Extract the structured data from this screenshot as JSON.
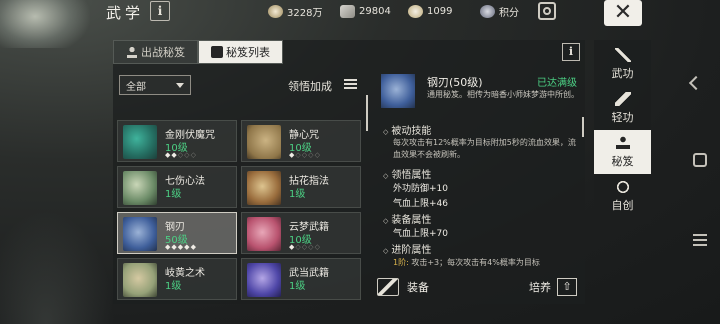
{
  "header": {
    "title": "武学",
    "info_label": "i",
    "resources": [
      {
        "icon": "coin-icon",
        "value": "3228万"
      },
      {
        "icon": "token-icon",
        "value": "29804"
      },
      {
        "icon": "silver-icon",
        "value": "1099"
      },
      {
        "icon": "points-icon",
        "value": "积分"
      }
    ],
    "close_label": "✕"
  },
  "tabs": [
    {
      "label": "出战秘笈",
      "active": false
    },
    {
      "label": "秘笈列表",
      "active": true
    }
  ],
  "panel_info_label": "i",
  "filter": {
    "selected": "全部"
  },
  "sort_label": "领悟加成",
  "manuals": [
    {
      "name": "金刚伏魔咒",
      "level": "10级",
      "stars": 2,
      "max": 5
    },
    {
      "name": "静心咒",
      "level": "10级",
      "stars": 1,
      "max": 5
    },
    {
      "name": "七伤心法",
      "level": "1级",
      "stars": 0,
      "max": 0
    },
    {
      "name": "拈花指法",
      "level": "1级",
      "stars": 0,
      "max": 0
    },
    {
      "name": "钢刃",
      "level": "50级",
      "stars": 5,
      "max": 5,
      "selected": true
    },
    {
      "name": "云梦武籍",
      "level": "10级",
      "stars": 1,
      "max": 5
    },
    {
      "name": "岐黄之术",
      "level": "1级",
      "stars": 0,
      "max": 0
    },
    {
      "name": "武当武籍",
      "level": "1级",
      "stars": 0,
      "max": 0
    }
  ],
  "detail": {
    "name": "钢刃(50级)",
    "status": "已达满级",
    "description": "通用秘笈。相传为暗香小师妹梦游中所创。",
    "passive_title": "被动技能",
    "passive_text": "每次攻击有12%概率为目标附加5秒的流血效果，流血效果不会被刷新。",
    "comprehend_title": "领悟属性",
    "comprehend_attrs": [
      "外功防御+10",
      "气血上限+46"
    ],
    "equip_title": "装备属性",
    "equip_attrs": [
      "气血上限+70"
    ],
    "advance_title": "进阶属性",
    "advance_stage": "1阶:",
    "advance_text": " 攻击+3；每次攻击有4%概率为目标"
  },
  "actions": {
    "equip_label": "装备",
    "train_label": "培养",
    "train_icon": "⇧"
  },
  "sidenav": [
    {
      "label": "武功",
      "active": false
    },
    {
      "label": "轻功",
      "active": false
    },
    {
      "label": "秘笈",
      "active": true
    },
    {
      "label": "自创",
      "active": false
    }
  ]
}
